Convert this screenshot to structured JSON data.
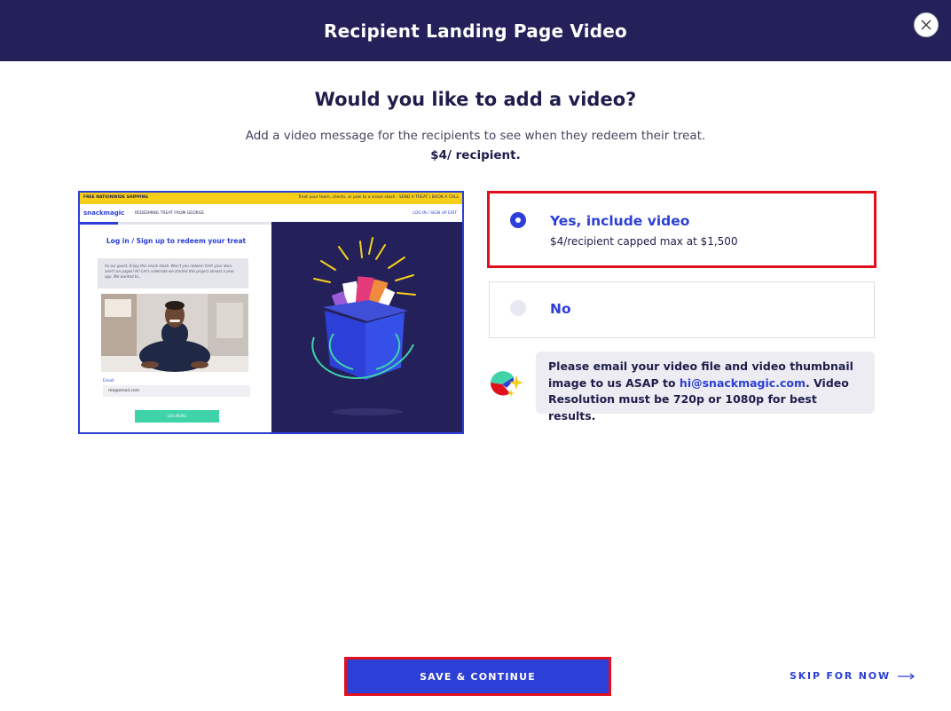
{
  "header": {
    "title": "Recipient Landing Page Video",
    "close_icon": "close-icon"
  },
  "prompt": {
    "title": "Would you like to add a video?",
    "subtitle": "Add a video message for the recipients to see when they redeem their treat.",
    "price": "$4/ recipient."
  },
  "preview": {
    "banner_left": "FREE NATIONWIDE SHIPPING",
    "banner_right": "Treat your team, clients, or pals to a snack stash  ·  SEND A TREAT  |  BOOK A CALL",
    "logo": "snackmagic",
    "nav_mid": "REDEEMING TREAT FROM GEORGE",
    "nav_right": "LOG IN / SIGN UP     EXIT",
    "progress": 0.2,
    "heading": "Log in / Sign up to redeem your treat",
    "message": "As our guest, Enjoy this snack stash. Won't you redeem first! your docs aren't on pages! Hi! Let's celebrate we started this project almost a year ago. We wanted to...",
    "email_label": "Email",
    "email_value": "me@email.com",
    "button": "LOG IN/SIG"
  },
  "options": {
    "yes": {
      "label": "Yes, include video",
      "sub": "$4/recipient capped max at $1,500",
      "selected": true
    },
    "no": {
      "label": "No",
      "selected": false
    }
  },
  "note": {
    "text_before": "Please email your video file and video thumbnail image to us ASAP to ",
    "email": "hi@snackmagic.com",
    "text_after": ". Video Resolution must be 720p or 1080p for best results."
  },
  "footer": {
    "save_label": "SAVE & CONTINUE",
    "skip_label": "SKIP FOR NOW"
  },
  "colors": {
    "navy": "#24215a",
    "accent": "#2c3fd6",
    "highlight": "#e0101f",
    "banner": "#f6cf1b",
    "mint": "#3fd3a9"
  }
}
